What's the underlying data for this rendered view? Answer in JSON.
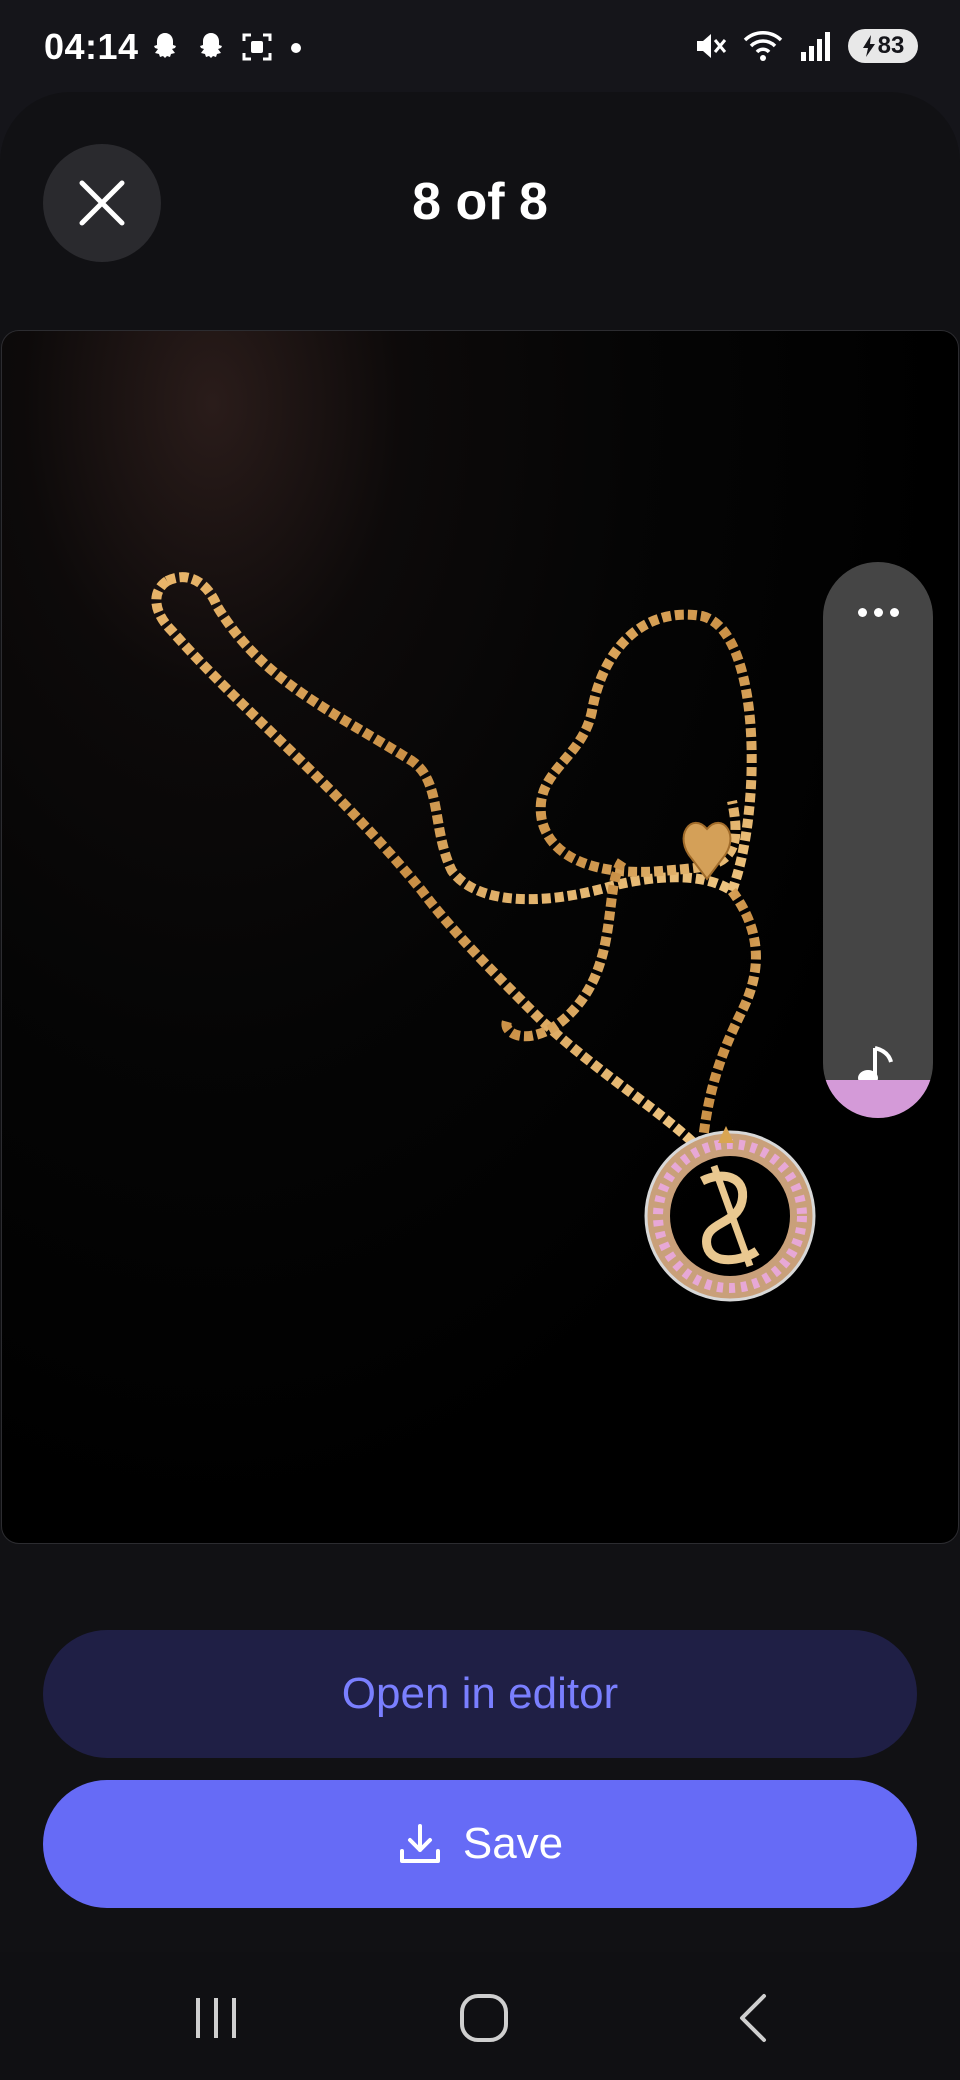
{
  "status_bar": {
    "time": "04:14",
    "left_icons": [
      "snapchat-icon",
      "snapchat-icon",
      "screenshot-icon",
      "dot-icon"
    ],
    "right_icons": [
      "mute-icon",
      "wifi-icon",
      "signal-icon"
    ],
    "battery": "83"
  },
  "header": {
    "title": "8 of 8",
    "close_icon": "close-icon"
  },
  "image": {
    "subject": "gold chain necklace with heart charm and circular pendant"
  },
  "side_panel": {
    "more_icon": "more-horizontal-icon",
    "music_icon": "music-note-icon",
    "accent_color": "#d49ad8"
  },
  "actions": {
    "open_editor_label": "Open in editor",
    "save_label": "Save",
    "save_icon": "download-icon"
  },
  "nav_bar": {
    "items": [
      "recent-apps-icon",
      "home-icon",
      "back-icon"
    ]
  },
  "colors": {
    "background": "#111114",
    "primary": "#666bf6",
    "primary_dark": "#1f1f45",
    "primary_text": "#7a7fff"
  }
}
